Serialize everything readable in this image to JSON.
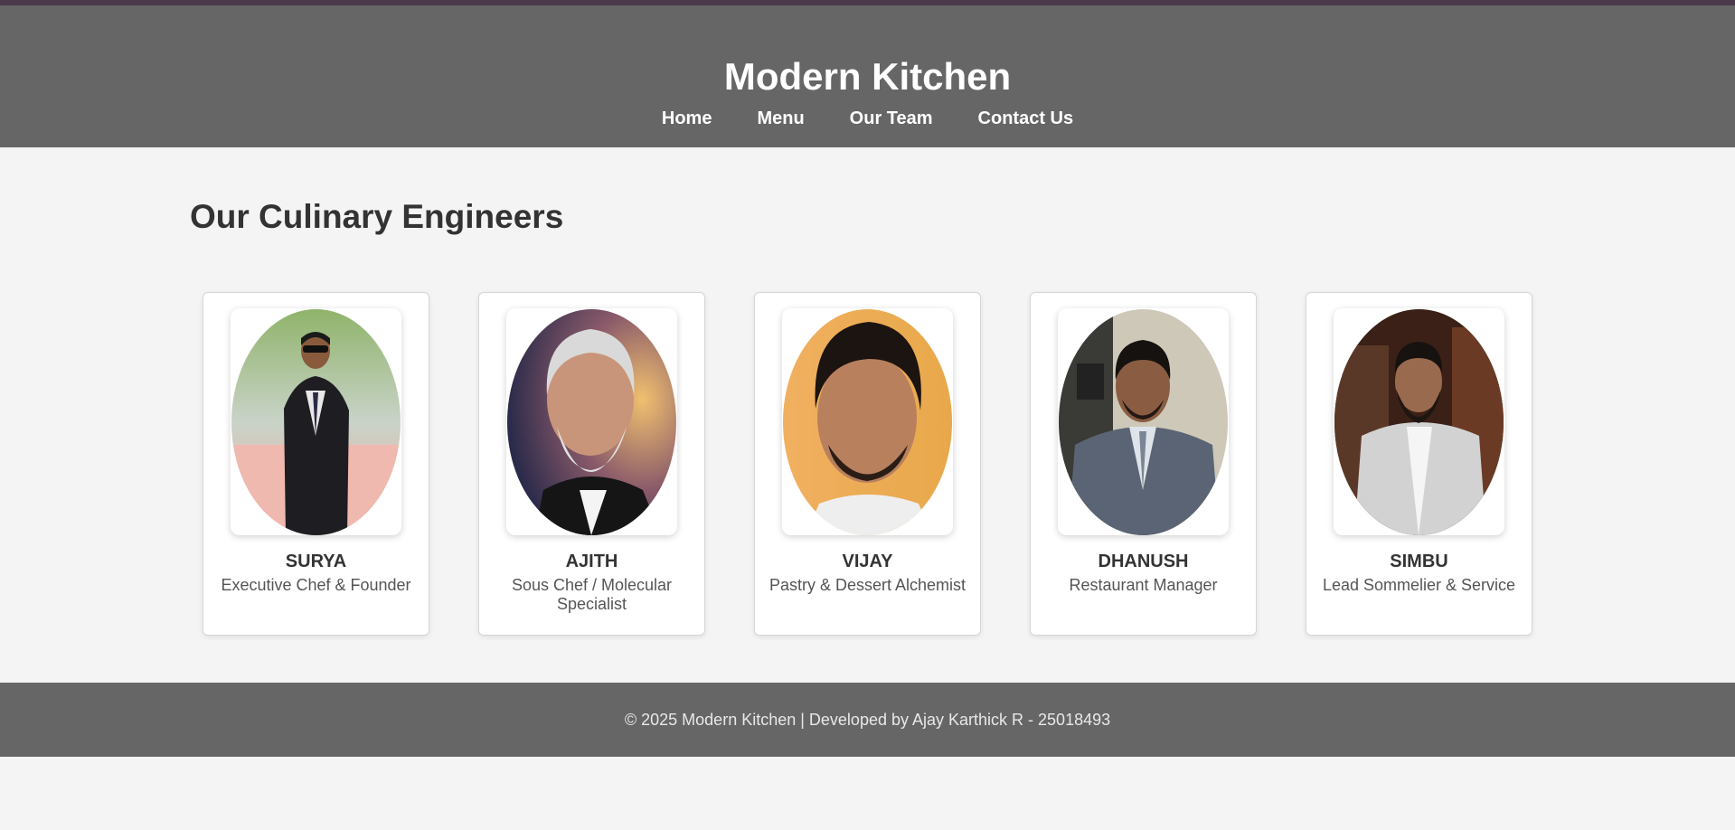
{
  "header": {
    "title": "Modern Kitchen",
    "nav": [
      "Home",
      "Menu",
      "Our Team",
      "Contact Us"
    ]
  },
  "main": {
    "section_title": "Our Culinary Engineers",
    "team": [
      {
        "name": "SURYA",
        "role": "Executive Chef & Founder"
      },
      {
        "name": "AJITH",
        "role": "Sous Chef / Molecular Specialist"
      },
      {
        "name": "VIJAY",
        "role": "Pastry & Dessert Alchemist"
      },
      {
        "name": "DHANUSH",
        "role": "Restaurant Manager"
      },
      {
        "name": "SIMBU",
        "role": "Lead Sommelier & Service"
      }
    ]
  },
  "footer": {
    "text": "© 2025 Modern Kitchen | Developed by Ajay Karthick R - 25018493"
  },
  "colors": {
    "header_bg": "#666666",
    "page_bg": "#f4f4f4",
    "top_accent": "#4b3a4b"
  }
}
